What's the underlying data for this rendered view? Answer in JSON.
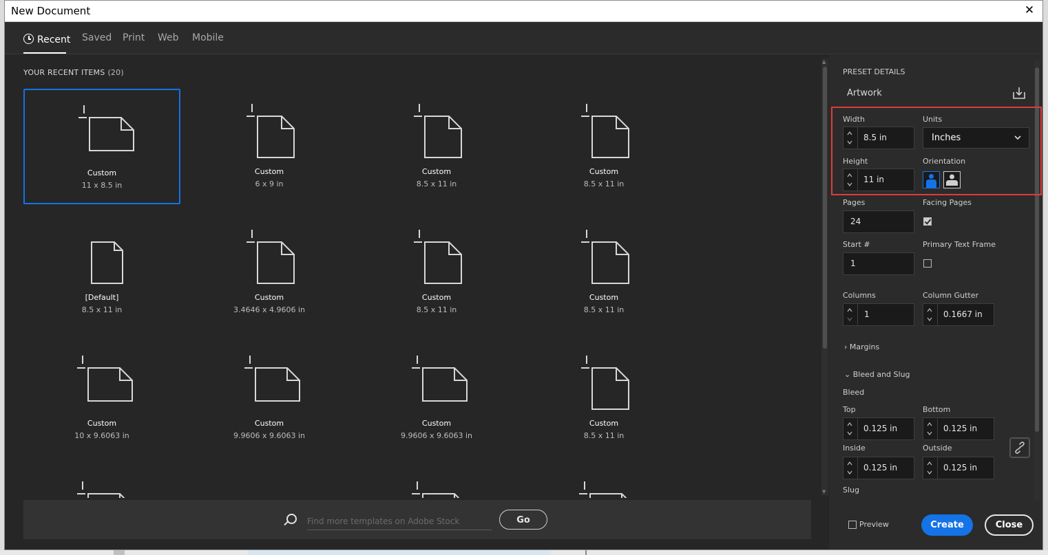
{
  "window": {
    "title": "New Document"
  },
  "tabs": [
    {
      "label": "Recent"
    },
    {
      "label": "Saved"
    },
    {
      "label": "Print"
    },
    {
      "label": "Web"
    },
    {
      "label": "Mobile"
    }
  ],
  "recent": {
    "heading": "YOUR RECENT ITEMS",
    "count": "(20)",
    "items": [
      {
        "name": "Custom",
        "size": "11 x 8.5 in"
      },
      {
        "name": "Custom",
        "size": "6 x 9 in"
      },
      {
        "name": "Custom",
        "size": "8.5 x 11 in"
      },
      {
        "name": "Custom",
        "size": "8.5 x 11 in"
      },
      {
        "name": "[Default]",
        "size": "8.5 x 11 in"
      },
      {
        "name": "Custom",
        "size": "3.4646 x 4.9606 in"
      },
      {
        "name": "Custom",
        "size": "8.5 x 11 in"
      },
      {
        "name": "Custom",
        "size": "8.5 x 11 in"
      },
      {
        "name": "Custom",
        "size": "10 x 9.6063 in"
      },
      {
        "name": "Custom",
        "size": "9.9606 x 9.6063 in"
      },
      {
        "name": "Custom",
        "size": "9.9606 x 9.6063 in"
      },
      {
        "name": "Custom",
        "size": "8.5 x 11 in"
      }
    ]
  },
  "search": {
    "placeholder": "Find more templates on Adobe Stock",
    "go_label": "Go"
  },
  "preset": {
    "header": "PRESET DETAILS",
    "name": "Artwork",
    "width_label": "Width",
    "width_value": "8.5 in",
    "units_label": "Units",
    "units_value": "Inches",
    "height_label": "Height",
    "height_value": "11 in",
    "orientation_label": "Orientation",
    "pages_label": "Pages",
    "pages_value": "24",
    "facing_label": "Facing Pages",
    "start_label": "Start #",
    "start_value": "1",
    "primary_label": "Primary Text Frame",
    "columns_label": "Columns",
    "columns_value": "1",
    "gutter_label": "Column Gutter",
    "gutter_value": "0.1667 in",
    "margins_label": "Margins",
    "bleed_slug_label": "Bleed and Slug",
    "bleed_label": "Bleed",
    "top_label": "Top",
    "top_value": "0.125 in",
    "bottom_label": "Bottom",
    "bottom_value": "0.125 in",
    "inside_label": "Inside",
    "inside_value": "0.125 in",
    "outside_label": "Outside",
    "outside_value": "0.125 in",
    "slug_label": "Slug"
  },
  "footer": {
    "preview_label": "Preview",
    "create_label": "Create",
    "close_label": "Close"
  },
  "colors": {
    "accent": "#1473e6",
    "highlight": "#e03b3b",
    "background": "#262626",
    "panel": "#2b2b2b"
  },
  "icons": {
    "recent": "clock-icon",
    "landscape_doc": "landscape-document-icon",
    "portrait_doc": "portrait-document-icon",
    "save": "save-preset-icon",
    "search": "search-icon",
    "link": "link-icon"
  }
}
